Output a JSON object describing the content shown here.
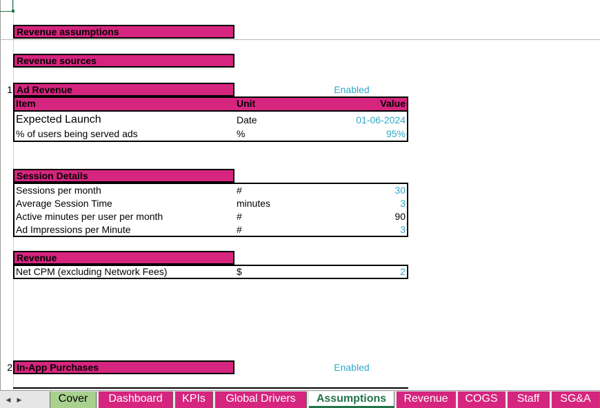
{
  "sections": {
    "revenue_assumptions": "Revenue assumptions",
    "revenue_sources": "Revenue sources",
    "ad_revenue": {
      "index": "1",
      "title": "Ad Revenue",
      "status": "Enabled"
    },
    "in_app": {
      "index": "2",
      "title": "In-App Purchases",
      "status": "Enabled"
    }
  },
  "table_headers": {
    "item": "Item",
    "unit": "Unit",
    "value": "Value"
  },
  "launch_table": [
    {
      "item": "Expected Launch",
      "unit": "Date",
      "value": "01-06-2024"
    },
    {
      "item": "% of users being served ads",
      "unit": "%",
      "value": "95%"
    }
  ],
  "session_details": {
    "title": "Session Details",
    "rows": [
      {
        "item": "Sessions per month",
        "unit": "#",
        "value": "30"
      },
      {
        "item": "Average Session Time",
        "unit": "minutes",
        "value": "3"
      },
      {
        "item": "Active minutes per user per month",
        "unit": "#",
        "value": "90"
      },
      {
        "item": "Ad Impressions per Minute",
        "unit": "#",
        "value": "3"
      }
    ]
  },
  "revenue": {
    "title": "Revenue",
    "rows": [
      {
        "item": "Net CPM (excluding Network Fees)",
        "unit": "$",
        "value": "2"
      }
    ]
  },
  "sheet_tabs": [
    "Cover",
    "Dashboard",
    "KPIs",
    "Global Drivers",
    "Assumptions",
    "Revenue",
    "COGS",
    "Staff",
    "SG&A"
  ],
  "active_tab": "Assumptions",
  "nav_icon": "next-sheet-arrow",
  "colors": {
    "accent": "#d6257f",
    "input_blue": "#2ea9c9",
    "excel_green": "#217346",
    "cover_tab": "#a9d18e"
  }
}
